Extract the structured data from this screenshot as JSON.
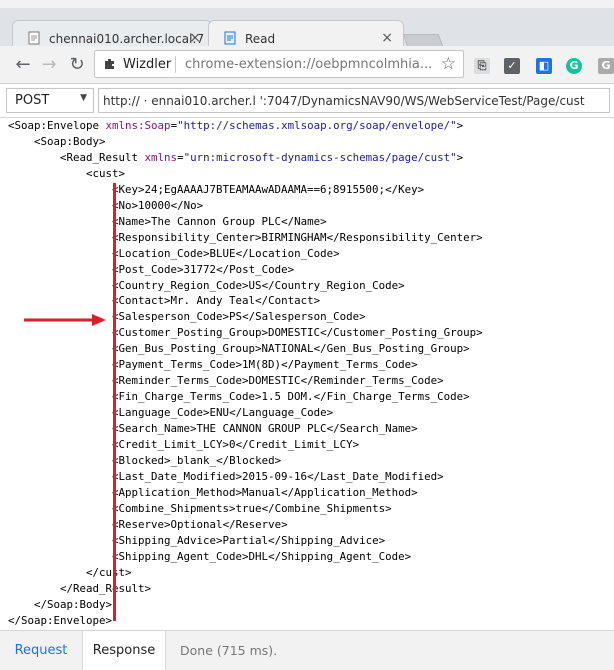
{
  "browser": {
    "tabs": [
      {
        "title": "chennai010.archer.local:7"
      },
      {
        "title": "Read"
      }
    ],
    "omnibox": {
      "title": "Wizdler",
      "url": "chrome-extension://oebpmncolmhia..."
    }
  },
  "request": {
    "method": "POST",
    "url": "http://  ·  ennai010.archer.l   ':7047/DynamicsNAV90/WS/WebServiceTest/Page/cust"
  },
  "xml": {
    "envelope_tag": "Soap:Envelope",
    "envelope_attr": "xmlns:Soap",
    "envelope_ns": "\"http://schemas.xmlsoap.org/soap/envelope/\"",
    "body_tag": "Soap:Body",
    "read_result_tag": "Read_Result",
    "read_result_attr": "xmlns",
    "read_result_ns": "\"urn:microsoft-dynamics-schemas/page/cust\"",
    "cust_tag": "cust",
    "fields": [
      {
        "name": "Key",
        "value": "24;EgAAAAJ7BTEAMAAwADAAMA==6;8915500;"
      },
      {
        "name": "No",
        "value": "10000"
      },
      {
        "name": "Name",
        "value": "The Cannon Group PLC"
      },
      {
        "name": "Responsibility_Center",
        "value": "BIRMINGHAM"
      },
      {
        "name": "Location_Code",
        "value": "BLUE"
      },
      {
        "name": "Post_Code",
        "value": "31772"
      },
      {
        "name": "Country_Region_Code",
        "value": "US"
      },
      {
        "name": "Contact",
        "value": "Mr. Andy Teal"
      },
      {
        "name": "Salesperson_Code",
        "value": "PS"
      },
      {
        "name": "Customer_Posting_Group",
        "value": "DOMESTIC"
      },
      {
        "name": "Gen_Bus_Posting_Group",
        "value": "NATIONAL"
      },
      {
        "name": "Payment_Terms_Code",
        "value": "1M(8D)"
      },
      {
        "name": "Reminder_Terms_Code",
        "value": "DOMESTIC"
      },
      {
        "name": "Fin_Charge_Terms_Code",
        "value": "1.5 DOM."
      },
      {
        "name": "Language_Code",
        "value": "ENU"
      },
      {
        "name": "Search_Name",
        "value": "THE CANNON GROUP PLC"
      },
      {
        "name": "Credit_Limit_LCY",
        "value": "0"
      },
      {
        "name": "Blocked",
        "value": "_blank_"
      },
      {
        "name": "Last_Date_Modified",
        "value": "2015-09-16"
      },
      {
        "name": "Application_Method",
        "value": "Manual"
      },
      {
        "name": "Combine_Shipments",
        "value": "true"
      },
      {
        "name": "Reserve",
        "value": "Optional"
      },
      {
        "name": "Shipping_Advice",
        "value": "Partial"
      },
      {
        "name": "Shipping_Agent_Code",
        "value": "DHL"
      }
    ]
  },
  "bottom": {
    "request_tab": "Request",
    "response_tab": "Response",
    "status": "Done (715 ms)."
  },
  "colors": {
    "accent": "#1a73e8",
    "highlight": "#d9212b",
    "attribute": "#881280",
    "attribute_value": "#1a1aa6"
  },
  "icons": [
    "document-icon",
    "close-icon",
    "back-arrow-icon",
    "forward-arrow-icon",
    "reload-icon",
    "puzzle-icon",
    "star-icon",
    "extension-icon",
    "grammarly-icon"
  ]
}
